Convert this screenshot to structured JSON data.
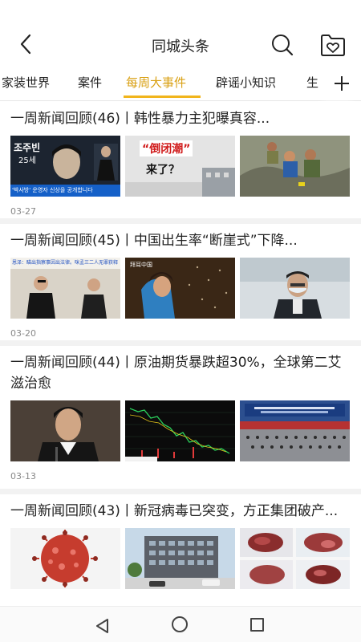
{
  "header": {
    "title": "同城头条",
    "back_icon": "back-arrow-icon",
    "search_icon": "search-icon",
    "favorites_icon": "heart-folder-icon"
  },
  "tabs": [
    {
      "label": "家装世界",
      "active": false
    },
    {
      "label": "案件",
      "active": false
    },
    {
      "label": "每周大事件",
      "active": true
    },
    {
      "label": "辟谣小知识",
      "active": false
    },
    {
      "label": "生",
      "active": false
    }
  ],
  "add_tab_icon": "plus-icon",
  "accent_color": "#f1b51c",
  "articles": [
    {
      "title": "一周新闻回顾(46)丨韩性暴力主犯曝真容...",
      "date": "03-27",
      "thumb1": {
        "name_text": "조주빈",
        "age_text": "25세",
        "caption": "'박사방' 운영자 신상을 공개합니다"
      },
      "thumb2": {
        "headline": "“倒闭潮”",
        "subline": "来了？"
      }
    },
    {
      "title": "一周新闻回顾(45)丨中国出生率“断崖式”下降...",
      "date": "03-20",
      "thumb1": {
        "caption": "恩泽：瞄出指察事因出法律。咪孟三二人无罪获释！"
      },
      "thumb2": {
        "caption": "拜耳中国"
      }
    },
    {
      "title": "一周新闻回顾(44)丨原油期货暴跌超30%，全球第二艾滋治愈",
      "date": "03-13"
    },
    {
      "title": "一周新闻回顾(43)丨新冠病毒已突变，方正集团破产...",
      "date": ""
    }
  ]
}
